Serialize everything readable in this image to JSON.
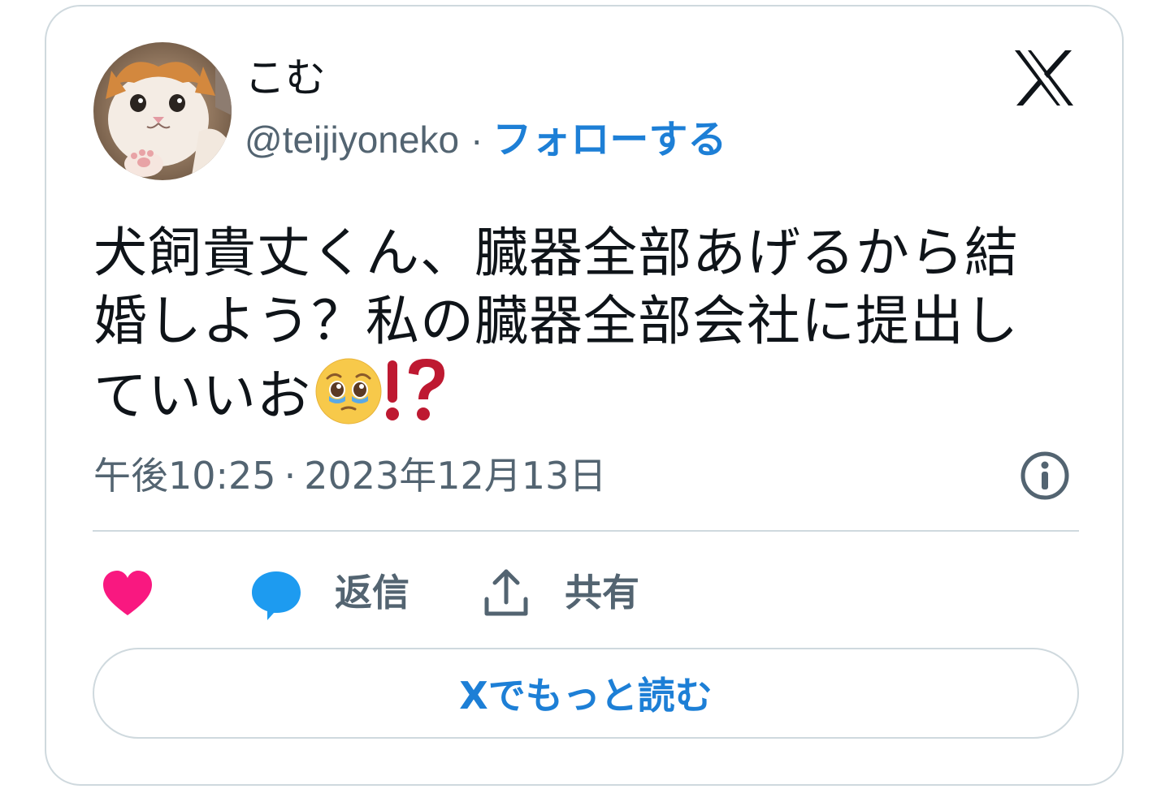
{
  "author": {
    "display_name": "こむ",
    "handle": "@teijiyoneko",
    "separator": "·",
    "follow_label": "フォローする",
    "avatar_icon": "cat-avatar"
  },
  "brand": {
    "logo_icon": "x-logo-icon"
  },
  "tweet": {
    "text_line1": "犬飼貴丈くん、臓器全部あげるから結",
    "text_line2": "婚しよう？私の臓器全部会社に提出し",
    "text_line3": "ていいお",
    "emoji_1": "pleading-tearful-face",
    "emoji_2": "exclamation-question-mark"
  },
  "meta": {
    "time": "午後10:25",
    "separator": "·",
    "date": "2023年12月13日",
    "info_icon": "info-icon"
  },
  "actions": {
    "like_icon": "heart-icon",
    "reply_icon": "reply-bubble-icon",
    "reply_label": "返信",
    "share_icon": "share-icon",
    "share_label": "共有"
  },
  "read_more": {
    "label": "Xでもっと読む"
  },
  "colors": {
    "text": "#0f1419",
    "muted": "#536471",
    "link": "#1d7fd6",
    "border": "#cfd9de",
    "heart": "#f91880",
    "reply": "#1d9bf0"
  }
}
